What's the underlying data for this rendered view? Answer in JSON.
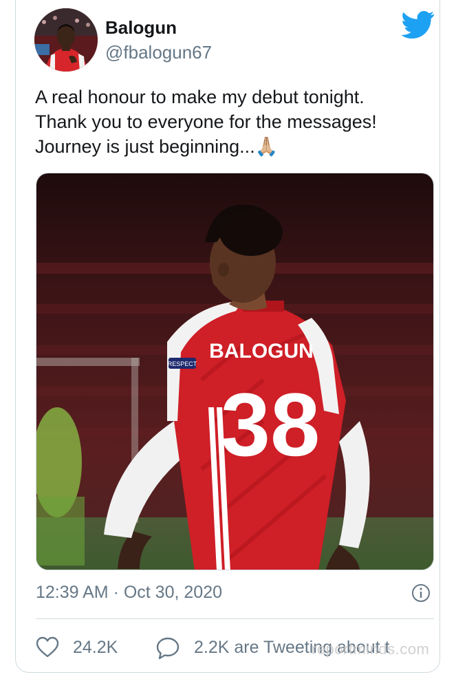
{
  "user": {
    "name": "Balogun",
    "handle": "@fbalogun67"
  },
  "tweet": {
    "lines": [
      "A real honour to make my debut tonight.",
      "Thank you to everyone for the messages!",
      "Journey is just beginning..."
    ],
    "emoji": "🙏🏼"
  },
  "photo": {
    "shirt_name": "BALOGUN",
    "shirt_number": "38",
    "sleeve_badge": "RESPECT"
  },
  "meta": {
    "timestamp": "12:39 AM · Oct 30, 2020"
  },
  "actions": {
    "likes": "24.2K",
    "reply_text": "2.2K are Tweeting about t"
  },
  "watermark": "reportminds.com",
  "icons": {
    "brand": "twitter-bird-icon",
    "info": "info-icon",
    "like": "heart-icon",
    "reply": "reply-bubble-icon"
  },
  "colors": {
    "brand": "#1da1f2",
    "secondary_text": "#657786",
    "border": "#cfd9de"
  }
}
